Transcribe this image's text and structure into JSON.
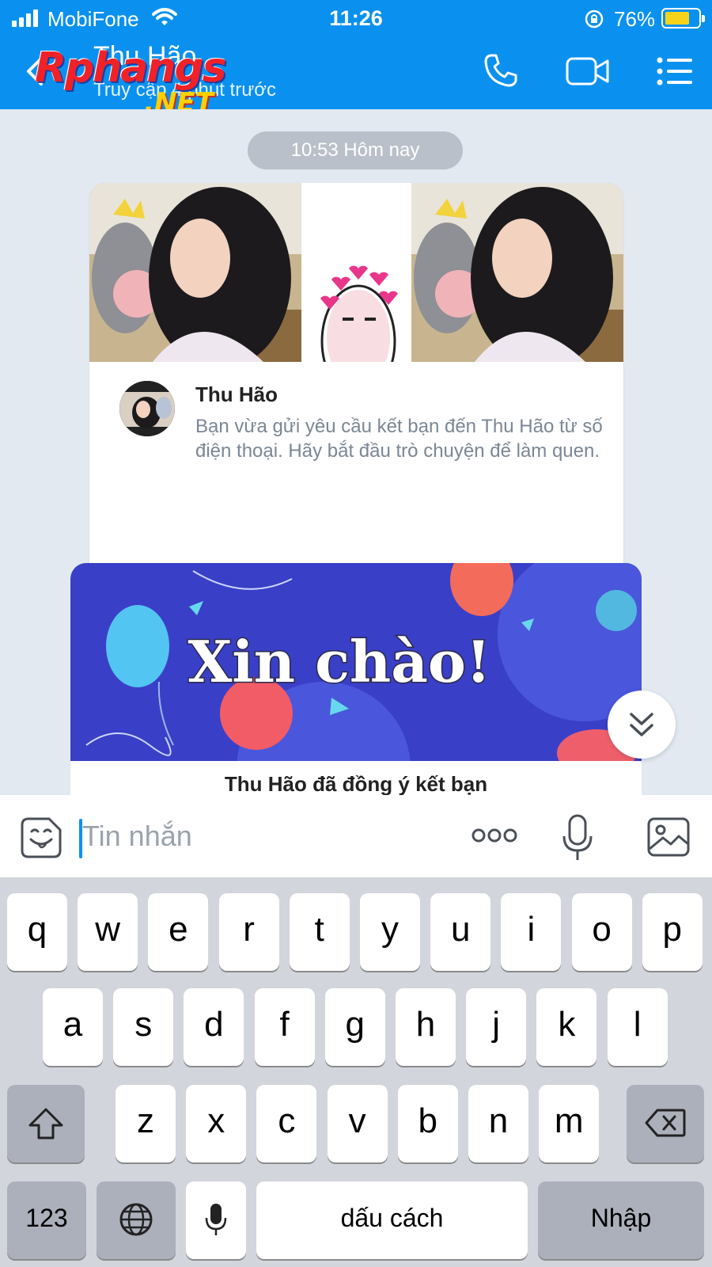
{
  "status_bar": {
    "carrier": "MobiFone",
    "time": "11:26",
    "battery_percent": "76%",
    "battery_level": 0.76
  },
  "header": {
    "contact_name": "Thu Hão",
    "last_seen": "Truy cập 4 phút trước",
    "background_color": "#0a91ef"
  },
  "watermark": {
    "main": "Rphangs",
    "suffix": ".NET"
  },
  "chat": {
    "date_separator": "10:53 Hôm nay",
    "friend_card": {
      "name": "Thu Hão",
      "text": "Bạn vừa gửi yêu cầu kết bạn đến Thu Hão từ số điện thoại. Hãy bắt đầu trò chuyện để làm quen."
    },
    "greeting_card": {
      "banner_text": "Xin chào!",
      "caption": "Thu Hão đã đồng ý kết bạn"
    }
  },
  "input_bar": {
    "placeholder": "Tin nhắn"
  },
  "keyboard": {
    "row1": [
      "q",
      "w",
      "e",
      "r",
      "t",
      "y",
      "u",
      "i",
      "o",
      "p"
    ],
    "row2": [
      "a",
      "s",
      "d",
      "f",
      "g",
      "h",
      "j",
      "k",
      "l"
    ],
    "row3": [
      "z",
      "x",
      "c",
      "v",
      "b",
      "n",
      "m"
    ],
    "numbers_key": "123",
    "space_key": "dấu cách",
    "return_key": "Nhập"
  },
  "icons": [
    "signal-icon",
    "wifi-icon",
    "rotation-lock-icon",
    "battery-icon",
    "back-icon",
    "phone-call-icon",
    "video-call-icon",
    "menu-icon",
    "chevron-double-down-icon",
    "sticker-icon",
    "more-icon",
    "microphone-icon",
    "image-icon",
    "shift-icon",
    "delete-icon",
    "globe-icon"
  ]
}
